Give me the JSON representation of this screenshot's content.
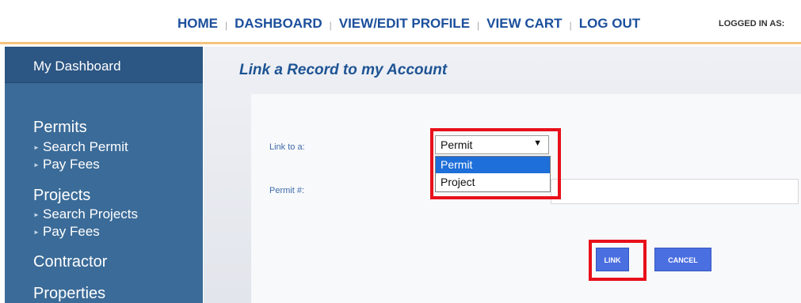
{
  "nav": {
    "links": [
      "HOME",
      "DASHBOARD",
      "VIEW/EDIT PROFILE",
      "VIEW CART",
      "LOG OUT"
    ],
    "separator": "|",
    "logged_in": "LOGGED IN AS:"
  },
  "sidebar": {
    "dashboard": "My Dashboard",
    "permits": {
      "label": "Permits",
      "items": [
        "Search Permit",
        "Pay Fees"
      ]
    },
    "projects": {
      "label": "Projects",
      "items": [
        "Search Projects",
        "Pay Fees"
      ]
    },
    "contractor": "Contractor",
    "properties": "Properties",
    "bullet": "►"
  },
  "main": {
    "title": "Link a Record to my Account",
    "link_to_label": "Link to a:",
    "select": {
      "value": "Permit",
      "arrow": "▼",
      "options": [
        "Permit",
        "Project"
      ]
    },
    "permit_label": "Permit #:",
    "permit_value": "",
    "link_button": "LINK",
    "cancel_button": "CANCEL"
  },
  "colors": {
    "nav_text": "#1b4f9c",
    "sidebar": "#3b6b98",
    "highlight": "#e8101a",
    "button": "#4a6fe0",
    "option_selected": "#1e6fd9"
  }
}
